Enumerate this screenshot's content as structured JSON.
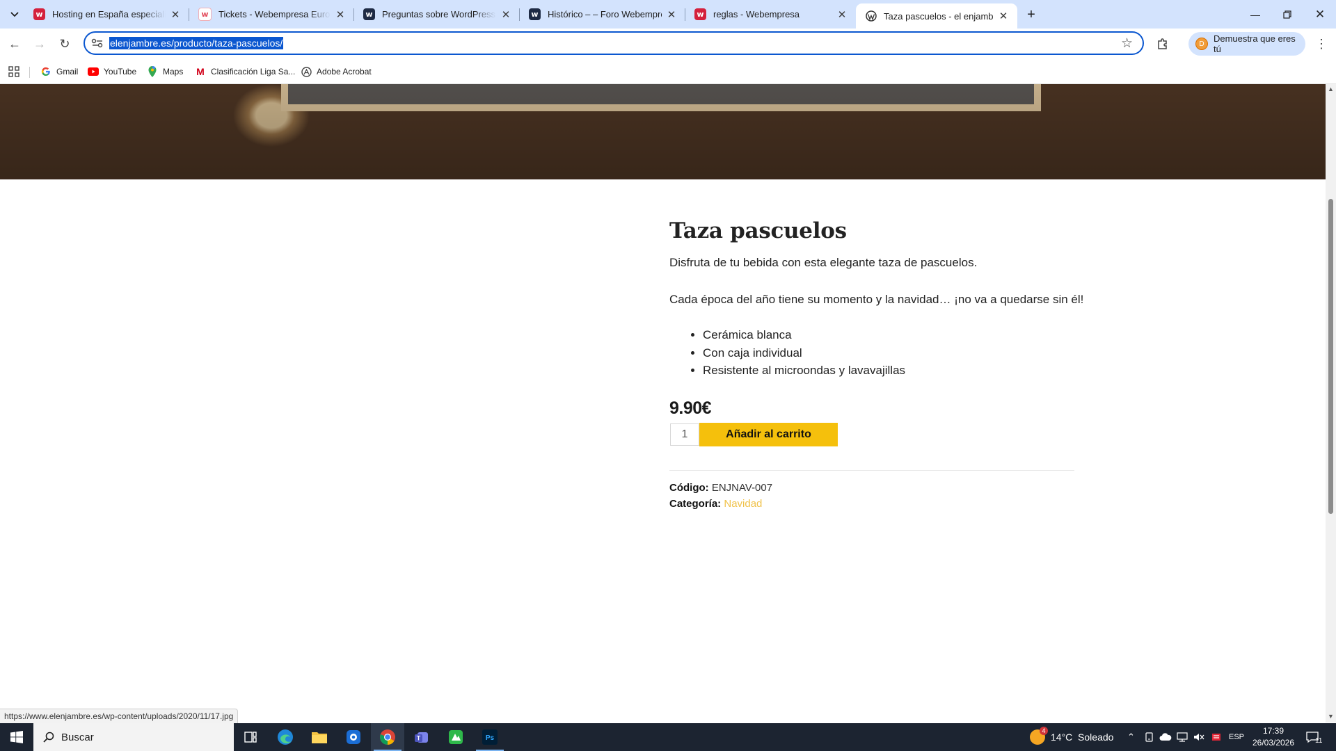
{
  "tabs": [
    {
      "title": "Hosting en España especializado",
      "favicon": "webempresa-logo-icon",
      "color": "#d4213d"
    },
    {
      "title": "Tickets - Webempresa Europa S.L.",
      "favicon": "webempresa-logo-icon",
      "color": "#e24a5a"
    },
    {
      "title": "Preguntas sobre WordPress – –",
      "favicon": "webempresa-dark-icon",
      "color": "#1e2b45"
    },
    {
      "title": "Histórico – – Foro Webempresa",
      "favicon": "webempresa-dark-icon",
      "color": "#1e2b45"
    },
    {
      "title": "reglas - Webempresa",
      "favicon": "webempresa-logo-icon",
      "color": "#d4213d"
    },
    {
      "title": "Taza pascuelos - el enjambre",
      "favicon": "wordpress-icon",
      "color": "#333333"
    }
  ],
  "browser": {
    "url": "elenjambre.es/producto/taza-pascuelos/",
    "profile_label": "Demuestra que eres tú",
    "profile_initial": "D"
  },
  "bookmarks": [
    {
      "label": "Gmail",
      "icon": "google-icon"
    },
    {
      "label": "YouTube",
      "icon": "youtube-icon"
    },
    {
      "label": "Maps",
      "icon": "maps-icon"
    },
    {
      "label": "Clasificación Liga Sa...",
      "icon": "marca-icon"
    },
    {
      "label": "Adobe Acrobat",
      "icon": "acrobat-icon"
    }
  ],
  "product": {
    "title": "Taza pascuelos",
    "desc1": "Disfruta de tu bebida con esta elegante taza de pascuelos.",
    "desc2": "Cada época del año tiene su momento y la navidad… ¡no va a quedarse sin él!",
    "features": [
      "Cerámica blanca",
      "Con caja individual",
      "Resistente al microondas y lavavajillas"
    ],
    "price": "9.90€",
    "quantity": "1",
    "add_to_cart": "Añadir al carrito",
    "sku_label": "Código:",
    "sku": "ENJNAV-007",
    "category_label": "Categoría:",
    "category": "Navidad"
  },
  "status_link": "https://www.elenjambre.es/wp-content/uploads/2020/11/17.jpg",
  "taskbar": {
    "search_label": "Buscar",
    "weather": "14°C  Soleado",
    "weather_badge": "4",
    "language": "ESP",
    "time": "17:39",
    "date": "26/03/2026",
    "notification_count": "11"
  }
}
